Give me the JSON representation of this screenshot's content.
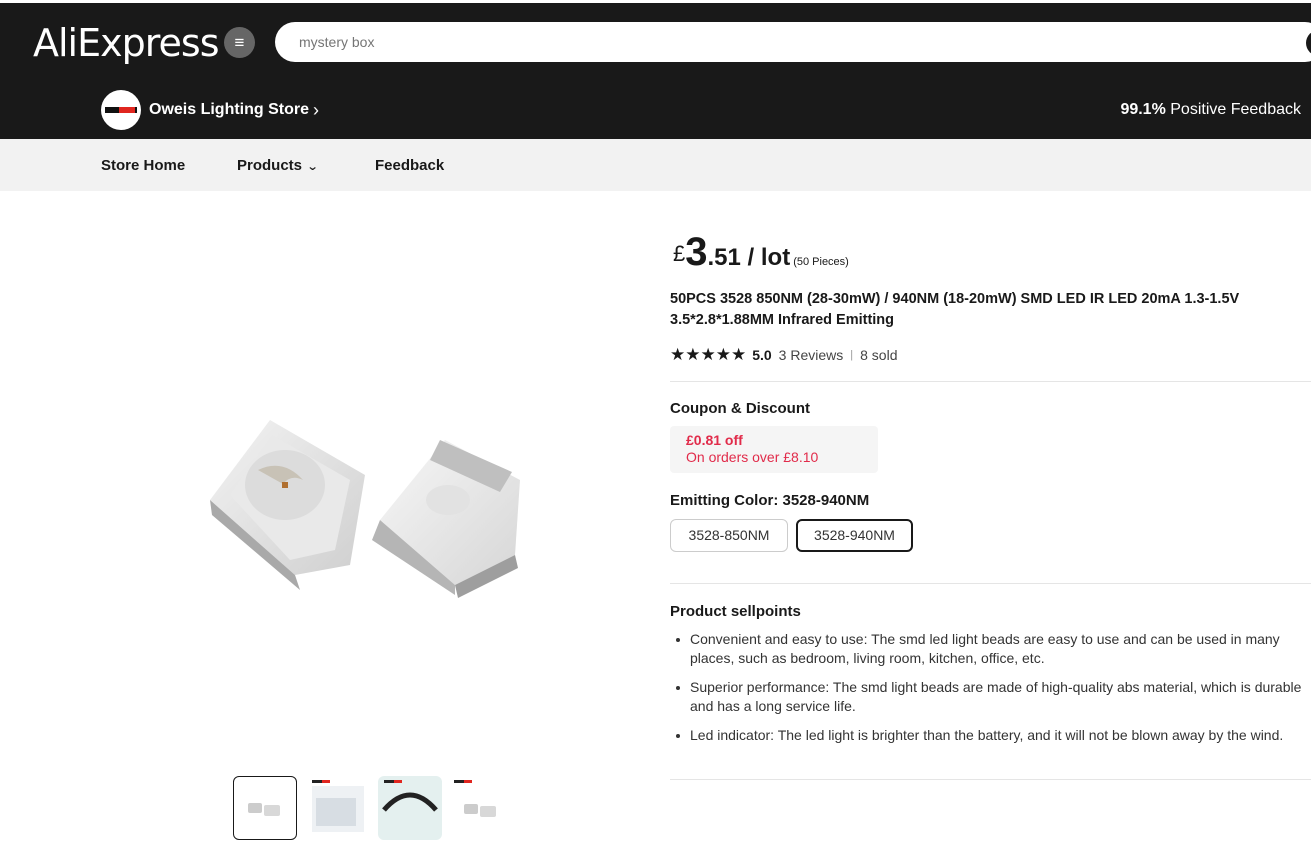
{
  "header": {
    "logo": "AliExpress",
    "menu_icon": "menu-icon",
    "search_placeholder": "mystery box",
    "search_icon": "search-icon"
  },
  "store": {
    "name": "Oweis Lighting Store",
    "feedback_value": "99.1%",
    "feedback_label": " Positive Feedback"
  },
  "nav": {
    "home": "Store Home",
    "products": "Products",
    "feedback": "Feedback"
  },
  "product": {
    "price_currency": "£",
    "price_int": "3",
    "price_dec": ".51",
    "price_unit": " / lot",
    "pieces": "(50 Pieces)",
    "title": "50PCS 3528 850NM (28-30mW) / 940NM (18-20mW) SMD LED IR LED 20mA 1.3-1.5V 3.5*2.8*1.88MM Infrared Emitting",
    "rating_score": "5.0",
    "stars": "★★★★★",
    "reviews": "3 Reviews",
    "sold": "8 sold"
  },
  "coupon": {
    "label": "Coupon & Discount",
    "amount": "£0.81 off",
    "condition": "On orders over £8.10"
  },
  "color": {
    "label": "Emitting Color: 3528-940NM",
    "options": [
      "3528-850NM",
      "3528-940NM"
    ],
    "selected": "3528-940NM"
  },
  "sellpoints": {
    "label": "Product sellpoints",
    "items": [
      "Convenient and easy to use: The smd led light beads are easy to use and can be used in many places, such as bedroom, living room, kitchen, office, etc.",
      "Superior performance: The smd light beads are made of high-quality abs material, which is durable and has a long service life.",
      "Led indicator: The led light is brighter than the battery, and it will not be blown away by the wind."
    ]
  },
  "colors": {
    "header_bg": "#191919",
    "nav_bg": "#f2f2f2",
    "coupon_red": "#e12b4a"
  }
}
